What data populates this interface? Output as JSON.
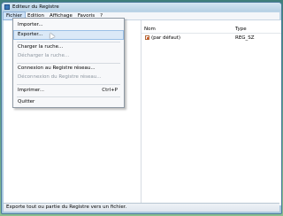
{
  "window": {
    "title": "Editeur du Registre"
  },
  "menubar": [
    "Fichier",
    "Edition",
    "Affichage",
    "Favoris",
    "?"
  ],
  "file_menu": [
    {
      "label": "Importer...",
      "shortcut": "",
      "disabled": false
    },
    {
      "label": "Exporter...",
      "shortcut": "",
      "disabled": false,
      "hover": true
    },
    {
      "label": "Charger la ruche...",
      "shortcut": "",
      "disabled": false
    },
    {
      "label": "Décharger la ruche...",
      "shortcut": "",
      "disabled": true
    },
    {
      "label": "Connexion au Registre réseau...",
      "shortcut": "",
      "disabled": false
    },
    {
      "label": "Déconnexion du Registre réseau...",
      "shortcut": "",
      "disabled": true
    },
    {
      "label": "Imprimer...",
      "shortcut": "Ctrl+P",
      "disabled": false
    },
    {
      "label": "Quitter",
      "shortcut": "",
      "disabled": false
    }
  ],
  "list": {
    "headers": {
      "name": "Nom",
      "type": "Type"
    },
    "rows": [
      {
        "name": "(par défaut)",
        "type": "REG_SZ"
      }
    ]
  },
  "status_text": "Exporte tout ou partie du Registre vers un fichier.",
  "colors": {
    "menu_hover": "#dbe9f7",
    "desktop": "#5a9a8c",
    "chrome": "#bfd7e8"
  }
}
